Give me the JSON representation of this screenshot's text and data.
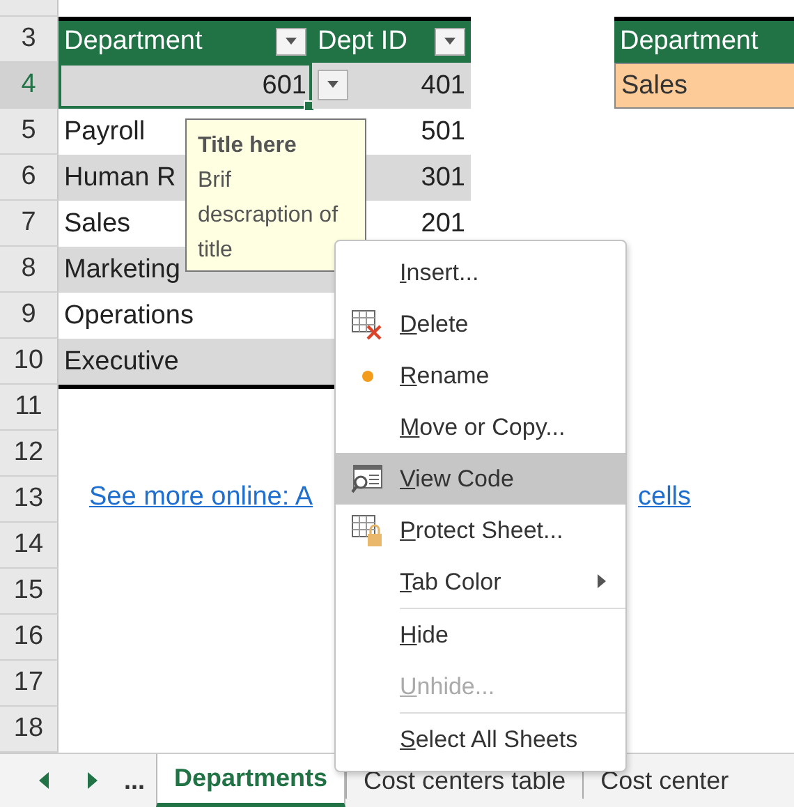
{
  "sheet_rows": [
    {
      "number": "3",
      "kind": "header",
      "columns": [
        "Department",
        "Dept ID"
      ],
      "side_header": "Department"
    },
    {
      "number": "4",
      "kind": "record",
      "department": "601",
      "dept_id": "401",
      "numeric": true,
      "selected": true,
      "side_value": "Sales"
    },
    {
      "number": "5",
      "kind": "record",
      "department": "Payroll",
      "dept_id": "501",
      "numeric": false,
      "selected": false
    },
    {
      "number": "6",
      "kind": "record",
      "department": "Human R",
      "dept_id": "301",
      "numeric": false,
      "selected": false
    },
    {
      "number": "7",
      "kind": "record",
      "department": "Sales",
      "dept_id": "201",
      "numeric": false,
      "selected": false
    },
    {
      "number": "8",
      "kind": "record",
      "department": "Marketing",
      "numeric": false,
      "selected": false
    },
    {
      "number": "9",
      "kind": "record",
      "department": "Operations",
      "numeric": false,
      "selected": false
    },
    {
      "number": "10",
      "kind": "record",
      "department": "Executive",
      "numeric": false,
      "selected": false
    },
    {
      "number": "11",
      "kind": "empty"
    },
    {
      "number": "12",
      "kind": "empty"
    },
    {
      "number": "13",
      "kind": "link",
      "link_parts": [
        "See more online: A",
        "cells"
      ]
    },
    {
      "number": "14",
      "kind": "empty"
    },
    {
      "number": "15",
      "kind": "empty"
    },
    {
      "number": "16",
      "kind": "empty"
    },
    {
      "number": "17",
      "kind": "empty"
    },
    {
      "number": "18",
      "kind": "empty"
    }
  ],
  "tooltip": {
    "title": "Title here",
    "text": "Brif descraption of title"
  },
  "context_menu": [
    {
      "kind": "plain",
      "label": "Insert...",
      "selected": false,
      "disabled": false
    },
    {
      "kind": "delete",
      "label": "Delete",
      "selected": false,
      "disabled": false
    },
    {
      "kind": "rename",
      "label": "Rename",
      "selected": false,
      "disabled": false
    },
    {
      "kind": "plain",
      "label": "Move or Copy...",
      "selected": false,
      "disabled": false
    },
    {
      "kind": "code",
      "label": "View Code",
      "selected": true,
      "disabled": false
    },
    {
      "kind": "protect",
      "label": "Protect Sheet...",
      "selected": false,
      "disabled": false
    },
    {
      "kind": "submenu",
      "label": "Tab Color",
      "selected": false,
      "disabled": false
    },
    {
      "kind": "separator"
    },
    {
      "kind": "plain",
      "label": "Hide",
      "selected": false,
      "disabled": false
    },
    {
      "kind": "plain",
      "label": "Unhide...",
      "selected": false,
      "disabled": true
    },
    {
      "kind": "separator"
    },
    {
      "kind": "plain",
      "label": "Select All Sheets",
      "selected": false,
      "disabled": false
    }
  ],
  "sheet_tabs": {
    "more": "...",
    "tabs": [
      {
        "label": "Departments",
        "selected": true
      },
      {
        "label": "Cost centers table",
        "selected": false
      },
      {
        "label": "Cost center",
        "selected": false
      }
    ]
  }
}
